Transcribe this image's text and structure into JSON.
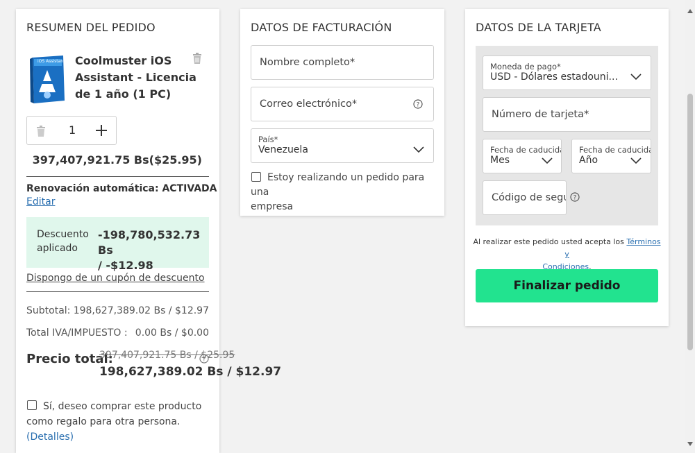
{
  "summary": {
    "title": "RESUMEN DEL PEDIDO",
    "product_name_lines": [
      "Coolmuster iOS",
      "Assistant - Licencia",
      "de 1 año (1 PC)"
    ],
    "product_box_text": "iOS Assistant",
    "quantity": "1",
    "price": "397,407,921.75 Bs($25.95)",
    "renewal": "Renovación automática: ACTIVADA",
    "edit_link": "Editar",
    "discount_label_lines": [
      "Descuento",
      "aplicado"
    ],
    "discount_value_lines": [
      "-198,780,532.73 Bs",
      "/ -$12.98"
    ],
    "coupon_link": "Dispongo de un cupón de descuento",
    "subtotal_label": "Subtotal:",
    "subtotal_value": "198,627,389.02 Bs / $12.97",
    "tax_label": "Total IVA/IMPUESTO :",
    "tax_value": "0.00 Bs / $0.00",
    "total_label": "Precio total:",
    "old_total": "397,407,921.75 Bs / $25.95",
    "new_total": "198,627,389.02 Bs / $12.97",
    "gift_lines": [
      "Sí, deseo comprar este producto",
      "como regalo para otra persona."
    ],
    "details_link": "(Detalles)"
  },
  "billing": {
    "title": "DATOS DE FACTURACIÓN",
    "name_placeholder": "Nombre completo*",
    "email_placeholder": "Correo electrónico*",
    "country_label": "País*",
    "country_value": "Venezuela",
    "company_lines": [
      "Estoy realizando un pedido para una",
      "empresa"
    ]
  },
  "card": {
    "title": "DATOS DE LA TARJETA",
    "currency_label": "Moneda de pago*",
    "currency_value": "USD - Dólares estadouni...",
    "card_number_placeholder": "Número de tarjeta*",
    "expiry_month_label": "Fecha de caducidad*",
    "expiry_month_value": "Mes",
    "expiry_year_label": "Fecha de caducidad*",
    "expiry_year_value": "Año",
    "cvv_placeholder": "Código de segu",
    "terms_prefix": "Al realizar este pedido usted acepta los ",
    "terms_link_part1": "Términos y",
    "terms_link_part2": "Condiciones",
    "terms_suffix": ".",
    "submit_label": "Finalizar pedido"
  },
  "colors": {
    "accent_green": "#22e38f",
    "discount_bg": "#e0f7ec",
    "link_blue": "#2a6fb0",
    "card_area_bg": "#e6e6e6"
  }
}
